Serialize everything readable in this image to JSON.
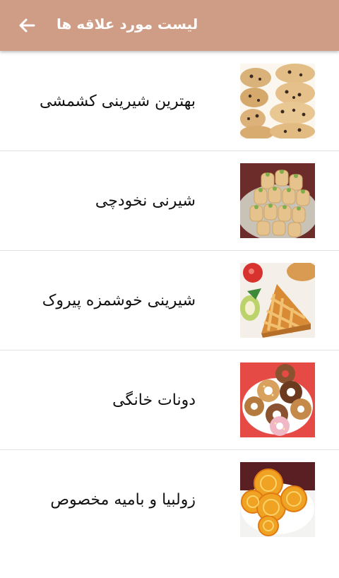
{
  "header": {
    "title": "لیست مورد علاقه ها",
    "back_icon": "arrow-left-icon",
    "background": "#cf9c86"
  },
  "favorites": [
    {
      "title": "بهترین شیرینی کشمشی",
      "image": "raisin-cookies-image"
    },
    {
      "title": "شیرنی نخودچی",
      "image": "chickpea-cookies-image"
    },
    {
      "title": "شیرینی خوشمزه پیروک",
      "image": "lattice-pie-image"
    },
    {
      "title": "دونات خانگی",
      "image": "donuts-image"
    },
    {
      "title": "زولبیا و بامیه مخصوص",
      "image": "zoolbia-image"
    }
  ]
}
